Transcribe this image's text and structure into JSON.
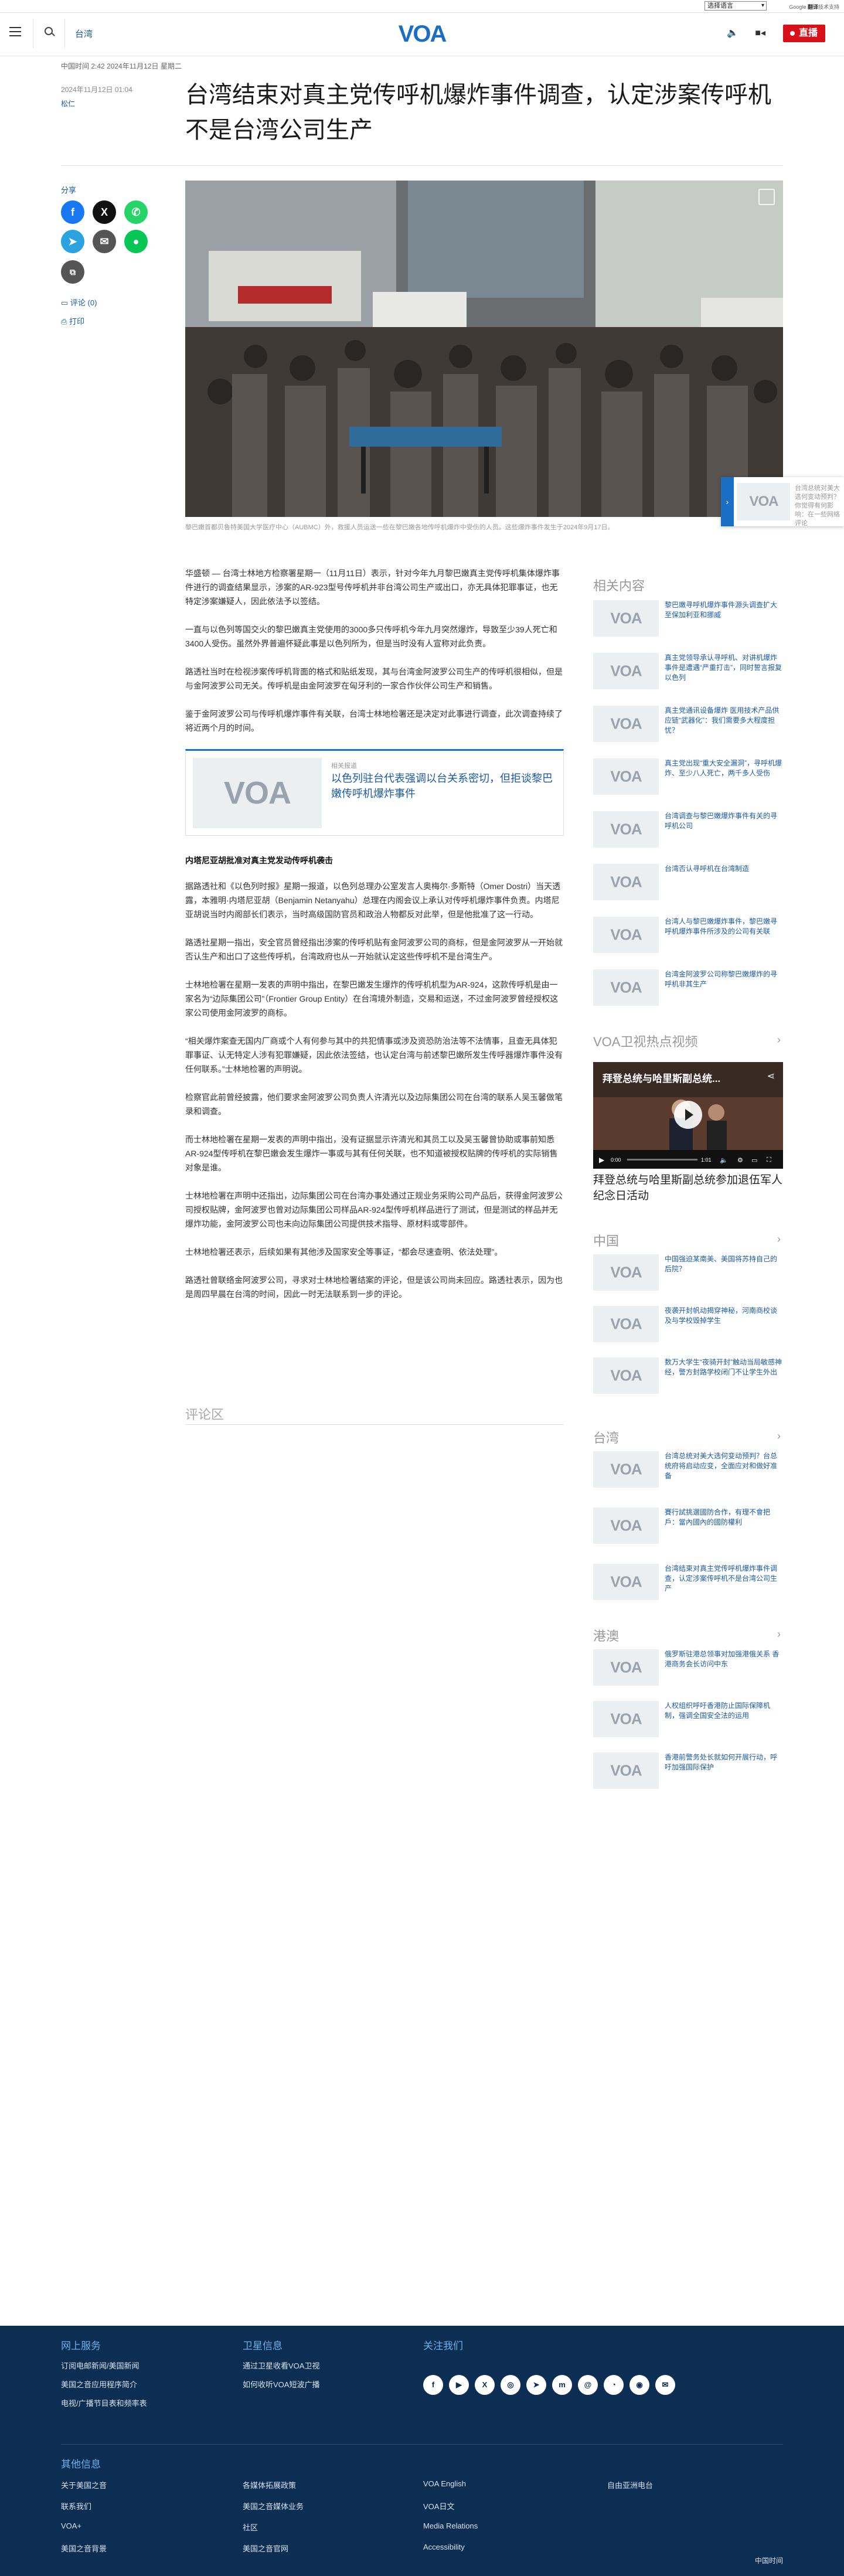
{
  "utility": {
    "language_select": "选择语言",
    "translate_credit_prefix": "Google",
    "translate_credit_brand": "翻译",
    "translate_credit_suffix": "技术支持"
  },
  "header": {
    "section": "台湾",
    "logo": "VOA",
    "live_label": "直播",
    "icons": [
      "menu-icon",
      "search-icon",
      "volume-icon",
      "video-camera-icon"
    ]
  },
  "article": {
    "time_line": "中国时间 2:42 2024年11月12日 星期二",
    "published": "2024年11月12日 01:04",
    "author": "松仁",
    "title": "台湾结束对真主党传呼机爆炸事件调查，认定涉案传呼机不是台湾公司生产",
    "caption": "黎巴嫩首都贝鲁特美国大学医疗中心（AUBMC）外，救援人员运送一些在黎巴嫩各地传呼机爆炸中受伤的人员。这些爆炸事件发生于2024年9月17日。",
    "paragraphs": [
      "华盛顿 — 台湾士林地方检察署星期一（11月11日）表示，针对今年九月黎巴嫩真主党传呼机集体爆炸事件进行的调查结果显示，涉案的AR-923型号传呼机并非台湾公司生产或出口，亦无具体犯罪事证，也无特定涉案嫌疑人，因此依法予以签结。",
      "一直与以色列等国交火的黎巴嫩真主党使用的3000多只传呼机今年九月突然爆炸，导致至少39人死亡和3400人受伤。虽然外界普遍怀疑此事是以色列所为，但是当时没有人宣称对此负责。",
      "路透社当时在检视涉案传呼机背面的格式和贴纸发现，其与台湾金阿波罗公司生产的传呼机很相似，但是与金阿波罗公司无关。传呼机是由金阿波罗在匈牙利的一家合作伙伴公司生产和销售。",
      "鉴于金阿波罗公司与传呼机爆炸事件有关联，台湾士林地检署还是决定对此事进行调查，此次调查持续了将近两个月的时间。"
    ],
    "related_card": {
      "label": "相关报道",
      "text": "以色列驻台代表强调以台关系密切，但拒谈黎巴嫩传呼机爆炸事件"
    },
    "subhead": "内塔尼亚胡批准对真主党发动传呼机袭击",
    "paragraphs2": [
      "据路透社和《以色列时报》星期一报道，以色列总理办公室发言人奥梅尔·多斯特（Omer Dostri）当天透露，本雅明·内塔尼亚胡（Benjamin Netanyahu）总理在内阁会议上承认对传呼机爆炸事件负责。内塔尼亚胡说当时内阁部长们表示，当时高级国防官员和政治人物都反对此举，但是他批准了这一行动。",
      "路透社星期一指出，安全官员曾经指出涉案的传呼机贴有金阿波罗公司的商标，但是金阿波罗从一开始就否认生产和出口了这些传呼机，台湾政府也从一开始就认定这些传呼机不是台湾生产。",
      "士林地检署在星期一发表的声明中指出，在黎巴嫩发生爆炸的传呼机机型为AR-924，这款传呼机是由一家名为“边际集团公司”（Frontier Group Entity）在台湾境外制造，交易和运送，不过金阿波罗曾经授权这家公司使用金阿波罗的商标。",
      "“相关爆炸案查无国内厂商或个人有何参与其中的共犯情事或涉及资恐防治法等不法情事，且查无具体犯罪事证、认无特定人涉有犯罪嫌疑，因此依法签结，也认定台湾与前述黎巴嫩所发生传呼器爆炸事件没有任何联系。”士林地检署的声明说。",
      "检察官此前曾经披露，他们要求金阿波罗公司负责人许清光以及边际集团公司在台湾的联系人吴玉馨做笔录和调查。",
      "而士林地检署在星期一发表的声明中指出，没有证据显示许清光和其员工以及吴玉馨曾协助或事前知悉AR-924型传呼机在黎巴嫩会发生爆炸一事或与其有任何关联，也不知道被授权贴牌的传呼机的实际销售对象是谁。",
      "士林地检署在声明中还指出，边际集团公司在台湾办事处通过正规业务采购公司产品后，获得金阿波罗公司授权贴牌，金阿波罗也曾对边际集团公司样品AR-924型传呼机样品进行了测试，但是测试的样品并无爆炸功能，金阿波罗公司也未向边际集团公司提供技术指导、原材料或零部件。",
      "士林地检署还表示，后续如果有其他涉及国家安全等事证，“都会尽速查明、依法处理”。",
      "路透社曾联络金阿波罗公司，寻求对士林地检署结案的评论，但是该公司尚未回应。路透社表示，因为也是周四早晨在台湾的时间，因此一时无法联系到一步的评论。"
    ],
    "comments_label": "评论区"
  },
  "share": {
    "label": "分享",
    "comments_link": "评论 (0)",
    "print_link": "打印"
  },
  "sticky": {
    "text": "台湾总统对美大选何变动预判？你觉得有何影响：在一些网络评论"
  },
  "sidebar": {
    "related": {
      "title": "相关内容",
      "items": [
        "黎巴嫩寻呼机爆炸事件源头调查扩大至保加利亚和挪威",
        "真主党领导承认寻呼机、对讲机爆炸事件是遭遇“严重打击”，同时誓言报复以色列",
        "真主党通讯设备爆炸 医用技术产品供应链“武器化”：我们需要多大程度担忧？",
        "真主党出现“重大安全漏洞”，寻呼机爆炸、至少八人死亡，两千多人受伤",
        "台湾调查与黎巴嫩爆炸事件有关的寻呼机公司",
        "台湾否认寻呼机在台湾制造",
        "台湾人与黎巴嫩爆炸事件，黎巴嫩寻呼机爆炸事件所涉及的公司有关联",
        "台湾金阿波罗公司称黎巴嫩爆炸的寻呼机非其生产"
      ]
    },
    "video": {
      "title": "VOA卫视热点视频",
      "overlay_title": "拜登总统与哈里斯副总统...",
      "caption": "拜登总统与哈里斯副总统参加退伍军人纪念日活动",
      "time": "0:00",
      "duration": "1:01"
    },
    "china": {
      "title": "中国",
      "items": [
        "中国强迫某南美、美国将苏持自己的后院？",
        "夜袭开封帆动揭穿神秘，河南商校谈及与学校毁掉学生",
        "数万大学生“夜骑开封”触动当局敏感神经，警方封路学校闭门不让学生外出"
      ]
    },
    "taiwan": {
      "title": "台湾",
      "items": [
        "台湾总统对美大选何变动预判？台总统府将启动应变，全面应对和做好准备",
        "賽行試挑選國防合作，有理不會把戶：當內國內的國防權利",
        "台湾结束对真主党传呼机爆炸事件调查，认定涉案传呼机不是台湾公司生产"
      ]
    },
    "hongkong": {
      "title": "港澳",
      "items": [
        "俄罗斯驻港总领事对加强港俄关系 香港商务会长访问中东",
        "人权组织呼吁香港防止国际保障机制，强调全国安全法的运用",
        "香港前警务处长就如何开展行动，呼吁加强国际保护"
      ]
    }
  },
  "footer": {
    "col1": {
      "title": "网上服务",
      "links": [
        "订阅电邮新闻/美国新闻",
        "美国之音应用程序简介",
        "电视/广播节目表和频率表"
      ]
    },
    "col2": {
      "title": "卫星信息",
      "links": [
        "通过卫星收看VOA卫视",
        "如何收听VOA短波广播"
      ]
    },
    "col3": {
      "title": "关注我们",
      "social_icons": [
        "facebook-icon",
        "youtube-icon",
        "x-icon",
        "instagram-icon",
        "telegram-icon",
        "mastodon-icon",
        "threads-icon",
        "rss-icon",
        "podcast-icon",
        "email-icon"
      ]
    },
    "other": {
      "title": "其他信息",
      "links": [
        [
          "关于美国之音",
          "各媒体拓展政策",
          "VOA English",
          "自由亚洲电台"
        ],
        [
          "联系我们",
          "美国之音媒体业务",
          "VOA日文",
          ""
        ],
        [
          "VOA+",
          "社区",
          "Media Relations",
          ""
        ],
        [
          "美国之音背景",
          "美国之音官网",
          "Accessibility",
          ""
        ]
      ]
    },
    "tagline": "中国时间"
  }
}
